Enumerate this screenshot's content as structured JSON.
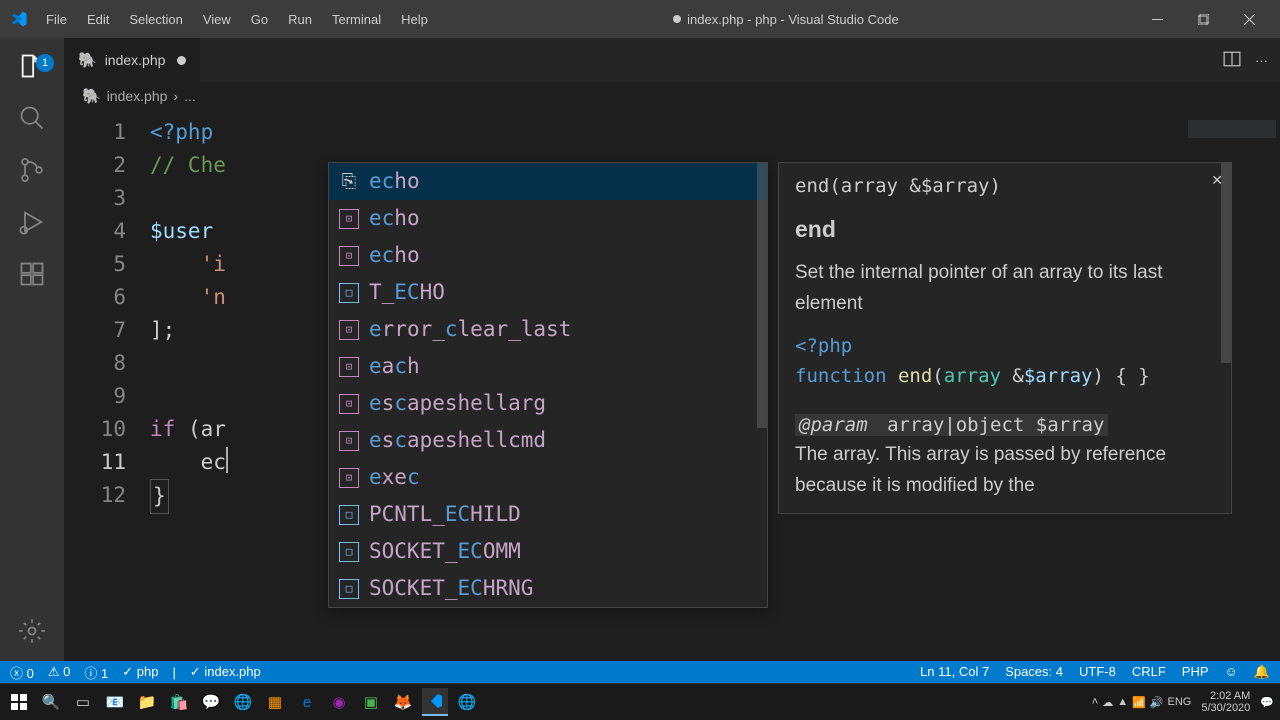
{
  "titlebar": {
    "menus": [
      "File",
      "Edit",
      "Selection",
      "View",
      "Go",
      "Run",
      "Terminal",
      "Help"
    ],
    "title": "index.php - php - Visual Studio Code"
  },
  "activitybar": {
    "badge": "1"
  },
  "tab": {
    "filename": "index.php"
  },
  "breadcrumb": {
    "file": "index.php",
    "tail": "..."
  },
  "code": {
    "lines": [
      "1",
      "2",
      "3",
      "4",
      "5",
      "6",
      "7",
      "8",
      "9",
      "10",
      "11",
      "12"
    ],
    "l1_open": "<?php",
    "l2_comment": "// Che",
    "l4_var": "$user",
    "l5_str": "'i",
    "l6_str": "'n",
    "l7": "];",
    "l10_if": "if",
    "l10_rest": " (ar",
    "l11": "ec",
    "l12": "}"
  },
  "suggestions": [
    {
      "icon": "snip",
      "pre": "ec",
      "post": "ho"
    },
    {
      "icon": "fn",
      "pre": "ec",
      "post": "ho"
    },
    {
      "icon": "fn",
      "pre": "ec",
      "post": "ho"
    },
    {
      "icon": "const",
      "pre": "",
      "post": "T_ECHO",
      "hlpos": [
        2,
        3
      ]
    },
    {
      "icon": "fn",
      "pre": "",
      "post": "error_clear_last",
      "hlpos": [
        0,
        6
      ]
    },
    {
      "icon": "fn",
      "pre": "ea",
      "post": "ch",
      "hlchar": "c"
    },
    {
      "icon": "fn",
      "pre": "es",
      "post": "capeshellarg"
    },
    {
      "icon": "fn",
      "pre": "es",
      "post": "capeshellcmd"
    },
    {
      "icon": "fn",
      "pre": "exe",
      "post": "c",
      "hlend": true
    },
    {
      "icon": "const",
      "pre": "",
      "post": "PCNTL_ECHILD"
    },
    {
      "icon": "const",
      "pre": "",
      "post": "SOCKET_ECOMM"
    },
    {
      "icon": "const",
      "pre": "",
      "post": "SOCKET_ECHRNG"
    }
  ],
  "signature": {
    "sigline": "end(array &$array)",
    "name": "end",
    "desc": "Set the internal pointer of an array to its last element",
    "code_open": "<?php",
    "code_fn": "function",
    "code_name": "end",
    "code_type": "array",
    "code_amp": "&",
    "code_var": "$array",
    "code_after": ") { }",
    "param_tag": "@param",
    "param_rest": " array|object $array",
    "param_desc": "The array. This array is passed by reference because it is modified by the"
  },
  "statusbar": {
    "errors": "0",
    "warnings": "0",
    "info": "1",
    "check1": "php",
    "check2": "index.php",
    "position": "Ln 11, Col 7",
    "spaces": "Spaces: 4",
    "encoding": "UTF-8",
    "eol": "CRLF",
    "lang": "PHP"
  },
  "systray": {
    "time": "2:02 AM",
    "date": "5/30/2020"
  }
}
